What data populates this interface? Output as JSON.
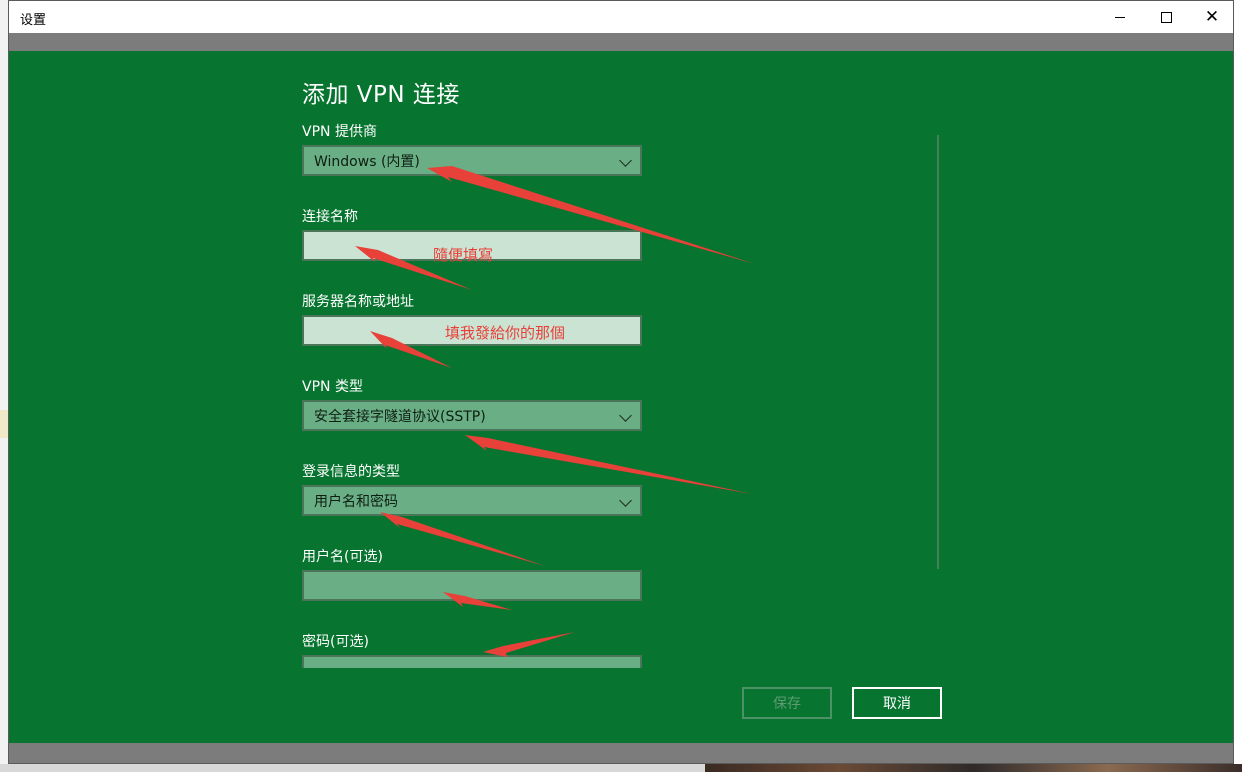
{
  "window": {
    "title": "设置",
    "minimize_symbol": "",
    "maximize_symbol": "",
    "close_symbol": "✕"
  },
  "page": {
    "title": "添加 VPN 连接"
  },
  "form": {
    "vpn_provider": {
      "label": "VPN 提供商",
      "value": "Windows (内置)"
    },
    "connection_name": {
      "label": "连接名称",
      "value": ""
    },
    "server": {
      "label": "服务器名称或地址",
      "value": ""
    },
    "vpn_type": {
      "label": "VPN 类型",
      "value": "安全套接字隧道协议(SSTP)"
    },
    "signin_type": {
      "label": "登录信息的类型",
      "value": "用户名和密码"
    },
    "username": {
      "label": "用户名(可选)",
      "value": ""
    },
    "password": {
      "label": "密码(可选)",
      "value": ""
    }
  },
  "annotations": {
    "connection_name_note": "隨便填寫",
    "server_note": "填我發給你的那個"
  },
  "buttons": {
    "save": "保存",
    "cancel": "取消"
  },
  "colors": {
    "window_background": "#07742f",
    "dropdown_fill": "#6aae85",
    "textbox_light_fill": "#cbe3d3",
    "annotation_red": "#e8413a"
  }
}
